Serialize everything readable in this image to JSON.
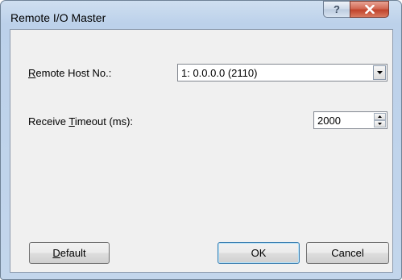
{
  "window": {
    "title": "Remote I/O Master",
    "help_glyph": "?",
    "close_glyph": "x"
  },
  "form": {
    "remote_host": {
      "label_pre": "",
      "label_mnemonic": "R",
      "label_post": "emote Host No.:",
      "value": "1: 0.0.0.0 (2110)"
    },
    "receive_timeout": {
      "label_pre": "Receive ",
      "label_mnemonic": "T",
      "label_post": "imeout (ms):",
      "value": "2000"
    }
  },
  "buttons": {
    "default_pre": "",
    "default_mnemonic": "D",
    "default_post": "efault",
    "ok": "OK",
    "cancel": "Cancel"
  },
  "colors": {
    "title_bar": "#c3d6ec",
    "client_area": "#f0f0f0",
    "close_button": "#c0432b"
  }
}
